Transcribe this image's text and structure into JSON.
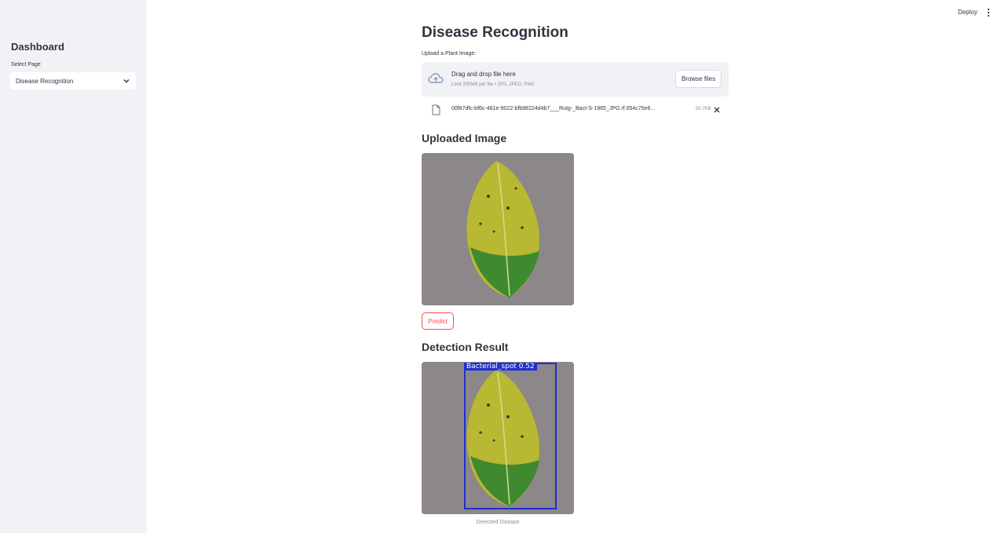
{
  "sidebar": {
    "title": "Dashboard",
    "select_label": "Select Page",
    "select_value": "Disease Recognition"
  },
  "header": {
    "deploy_label": "Deploy"
  },
  "main": {
    "title": "Disease Recognition",
    "uploader": {
      "label": "Upload a Plant Image:",
      "drop_text": "Drag and drop file here",
      "limit_text": "Limit 200MB per file • JPG, JPEG, PNG",
      "browse_label": "Browse files",
      "file_name": "00f87dfc-bf6c-481e-9022-bfb98224d4b7___Rutg-_Bact-S-1965_JPG.rf.054c75e6...",
      "file_size": "50.7KB"
    },
    "uploaded_heading": "Uploaded Image",
    "predict_label": "Predict",
    "result_heading": "Detection Result",
    "detection_label": "Bacterial_spot  0.52",
    "caption": "Detected Disease"
  },
  "colors": {
    "accent": "#ff4b4b",
    "sidebar_bg": "#f0f2f6",
    "bbox": "#1f2fd1"
  }
}
